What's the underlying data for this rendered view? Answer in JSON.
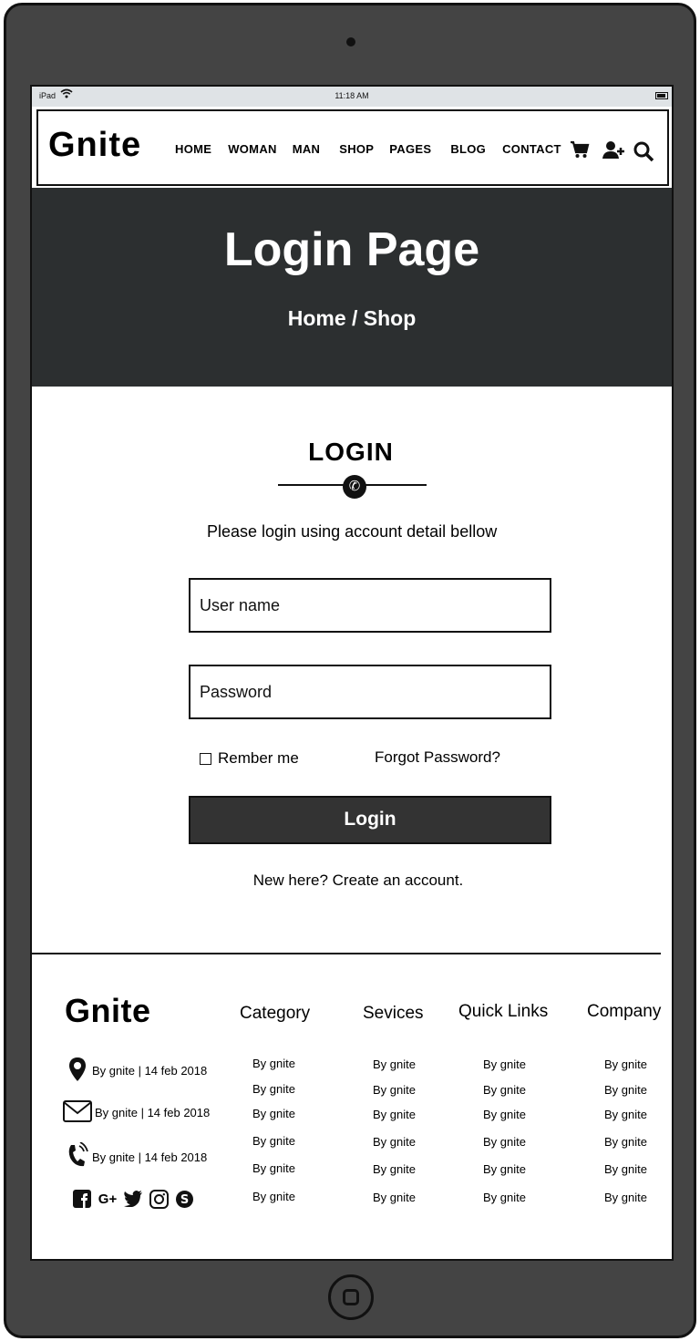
{
  "status": {
    "device": "iPad",
    "time": "11:18 AM"
  },
  "nav": {
    "logo": "Gnite",
    "items": [
      "HOME",
      "WOMAN",
      "MAN",
      "SHOP",
      "PAGES",
      "BLOG",
      "CONTACT"
    ],
    "icons": [
      "cart-icon",
      "add-user-icon",
      "search-icon"
    ]
  },
  "hero": {
    "title": "Login Page",
    "crumb_home": "Home",
    "crumb_sep": "/",
    "crumb_current": "Shop"
  },
  "login": {
    "heading": "LOGIN",
    "intro": "Please login using account detail bellow",
    "username_placeholder": "User name",
    "password_placeholder": "Password",
    "remember_label": "Rember me",
    "forgot_label": "Forgot Password?",
    "button_label": "Login",
    "create_account": "New here? Create an account."
  },
  "footer": {
    "logo": "Gnite",
    "contact": [
      {
        "icon": "map-pin-icon",
        "text": "By gnite | 14 feb 2018"
      },
      {
        "icon": "envelope-icon",
        "text": "By gnite | 14 feb 2018"
      },
      {
        "icon": "phone-icon",
        "text": "By gnite | 14 feb 2018"
      }
    ],
    "social_icons": [
      "facebook-icon",
      "google-plus-icon",
      "twitter-icon",
      "instagram-icon",
      "skype-icon"
    ],
    "columns": [
      {
        "title": "Category",
        "links": [
          "By gnite",
          "By gnite",
          "By gnite",
          "By gnite",
          "By gnite",
          "By gnite"
        ]
      },
      {
        "title": "Sevices",
        "links": [
          "By gnite",
          "By gnite",
          "By gnite",
          "By gnite",
          "By gnite",
          "By gnite"
        ]
      },
      {
        "title": "Quick Links",
        "links": [
          "By gnite",
          "By gnite",
          "By gnite",
          "By gnite",
          "By gnite",
          "By gnite"
        ]
      },
      {
        "title": "Company",
        "links": [
          "By gnite",
          "By gnite",
          "By gnite",
          "By gnite",
          "By gnite",
          "By gnite"
        ]
      }
    ]
  },
  "colors": {
    "device_frame": "#444444",
    "hero_bg": "#2c2f30",
    "button_bg": "#333333",
    "status_bar": "#dfe3e6"
  }
}
